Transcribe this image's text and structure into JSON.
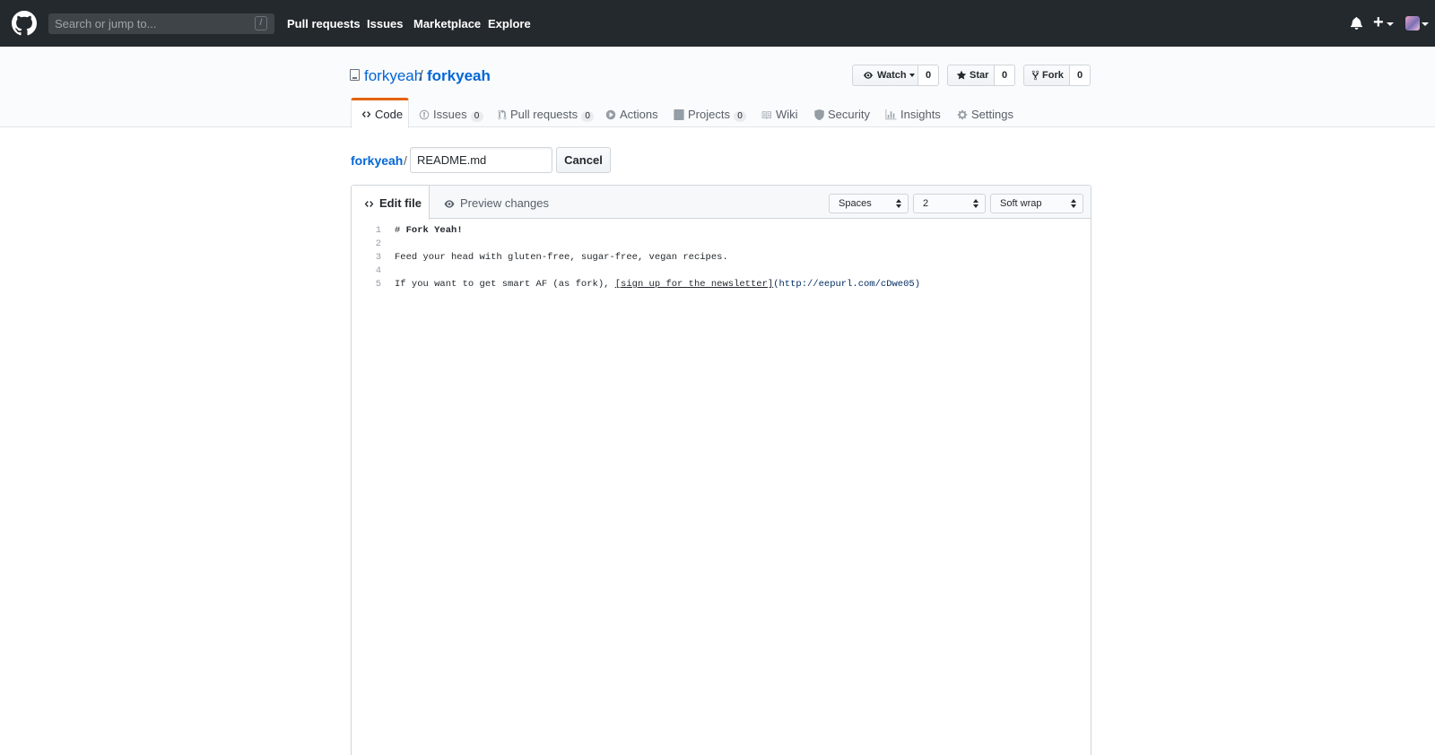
{
  "header": {
    "search_placeholder": "Search or jump to...",
    "search_key": "/",
    "nav": [
      "Pull requests",
      "Issues",
      "Marketplace",
      "Explore"
    ]
  },
  "repo": {
    "owner": "forkyeah",
    "separator": "/",
    "name": "forkyeah",
    "watch_label": "Watch",
    "watch_count": "0",
    "star_label": "Star",
    "star_count": "0",
    "fork_label": "Fork",
    "fork_count": "0"
  },
  "tabs": {
    "code": "Code",
    "issues": "Issues",
    "issues_count": "0",
    "pulls": "Pull requests",
    "pulls_count": "0",
    "actions": "Actions",
    "projects": "Projects",
    "projects_count": "0",
    "wiki": "Wiki",
    "security": "Security",
    "insights": "Insights",
    "settings": "Settings"
  },
  "edit": {
    "breadcrumb_repo": "forkyeah",
    "breadcrumb_sep": "/",
    "filename": "README.md",
    "cancel_label": "Cancel",
    "edit_tab": "Edit file",
    "preview_tab": "Preview changes",
    "indent_mode": "Spaces",
    "indent_size": "2",
    "wrap_mode": "Soft wrap"
  },
  "code_lines": {
    "n1": "1",
    "n2": "2",
    "n3": "3",
    "n4": "4",
    "n5": "5",
    "line1_hash": "# ",
    "line1_text": "Fork Yeah!",
    "line3": "Feed your head with gluten-free, sugar-free, vegan recipes.",
    "line5_prefix": "If you want to get smart AF (as fork), ",
    "line5_link_text": "[sign up for the newsletter]",
    "line5_url": "(http://eepurl.com/cDwe05)"
  },
  "colors": {
    "header_bg": "#24292e",
    "link": "#0366d6",
    "active_tab_accent": "#e36209"
  }
}
